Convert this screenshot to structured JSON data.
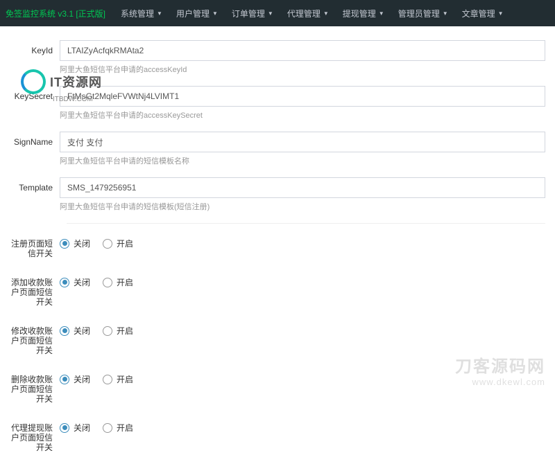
{
  "navbar": {
    "title": "免签监控系统 v3.1 [正式版]",
    "menus": [
      "系统管理",
      "用户管理",
      "订单管理",
      "代理管理",
      "提现管理",
      "管理员管理",
      "文章管理"
    ]
  },
  "fields": {
    "keyid": {
      "label": "KeyId",
      "value": "LTAIZyAcfqkRMAta2",
      "help": "阿里大鱼短信平台申请的accessKeyId"
    },
    "keysecret": {
      "label": "KeySecret",
      "value": "FtMsGt2MqleFVWtNj4LVIMT1",
      "help": "阿里大鱼短信平台申请的accessKeySecret"
    },
    "signname": {
      "label": "SignName",
      "value": "支付 支付",
      "help": "阿里大鱼短信平台申请的短信模板名称"
    },
    "template": {
      "label": "Template",
      "value": "SMS_1479256951",
      "help": "阿里大鱼短信平台申请的短信模板(短信注册)"
    }
  },
  "radio": {
    "off": "关闭",
    "on": "开启"
  },
  "switches": [
    {
      "label": "注册页面短信开关",
      "value": "off"
    },
    {
      "label": "添加收款账户页面短信开关",
      "value": "off"
    },
    {
      "label": "修改收款账户页面短信开关",
      "value": "off"
    },
    {
      "label": "删除收款账户页面短信开关",
      "value": "off"
    },
    {
      "label": "代理提现账户页面短信开关",
      "value": "off"
    }
  ],
  "watermark1": {
    "text": "IT资源网",
    "sub": "ITBDW.COM"
  },
  "watermark2": {
    "line1": "刀客源码网",
    "line2": "www.dkewl.com"
  }
}
